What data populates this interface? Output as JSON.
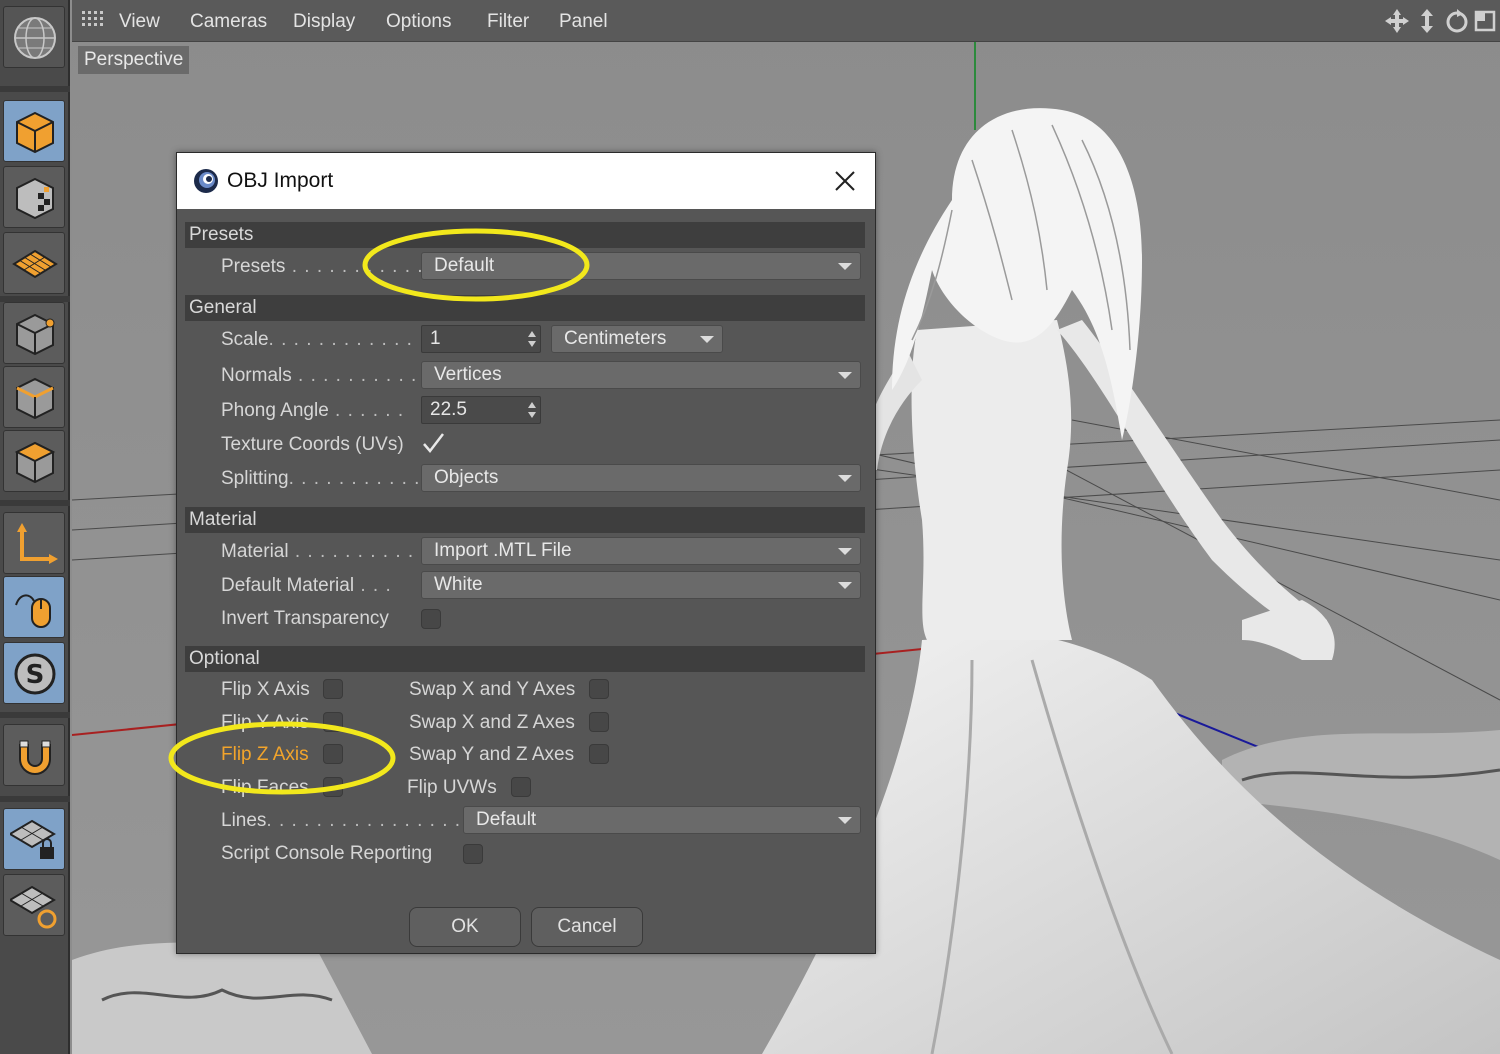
{
  "viewport": {
    "menu": [
      "View",
      "Cameras",
      "Display",
      "Options",
      "Filter",
      "Panel"
    ],
    "view_label": "Perspective"
  },
  "dialog": {
    "title": "OBJ Import",
    "presets": {
      "header": "Presets",
      "presets_label": "Presets",
      "presets_value": "Default"
    },
    "general": {
      "header": "General",
      "scale_label": "Scale",
      "scale_value": "1",
      "scale_unit": "Centimeters",
      "normals_label": "Normals",
      "normals_value": "Vertices",
      "phong_label": "Phong Angle",
      "phong_value": "22.5",
      "texture_label": "Texture Coords (UVs)",
      "texture_checked": true,
      "splitting_label": "Splitting",
      "splitting_value": "Objects"
    },
    "material": {
      "header": "Material",
      "material_label": "Material",
      "material_value": "Import .MTL File",
      "default_material_label": "Default Material",
      "default_material_value": "White",
      "invert_label": "Invert Transparency"
    },
    "optional": {
      "header": "Optional",
      "flip_x": "Flip X Axis",
      "flip_y": "Flip Y Axis",
      "flip_z": "Flip Z Axis",
      "flip_faces": "Flip Faces",
      "swap_xy": "Swap X and Y Axes",
      "swap_xz": "Swap X and Z Axes",
      "swap_yz": "Swap Y and Z Axes",
      "flip_uvws": "Flip UVWs",
      "lines_label": "Lines",
      "lines_value": "Default",
      "script_label": "Script Console Reporting"
    },
    "ok": "OK",
    "cancel": "Cancel"
  },
  "colors": {
    "highlight_text": "#f2a42b",
    "annotation": "#f2e81c",
    "active_tool": "#7fa2c8"
  },
  "icons": [
    "globe-icon",
    "cube-icon",
    "checker-cube-icon",
    "grid-plane-icon",
    "point-cube-icon",
    "edge-cube-icon",
    "polygon-cube-icon",
    "axis-icon",
    "mouse-icon",
    "snap-s-icon",
    "magnet-icon",
    "grid-lock-icon",
    "grid-sync-icon"
  ]
}
